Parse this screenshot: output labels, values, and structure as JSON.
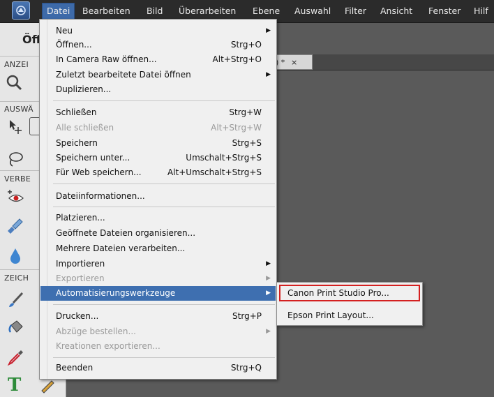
{
  "menubar": {
    "items": [
      "Datei",
      "Bearbeiten",
      "Bild",
      "Überarbeiten",
      "Ebene",
      "Auswahl",
      "Filter",
      "Ansicht",
      "Fenster",
      "Hilf"
    ]
  },
  "panel": {
    "heading": "Öff",
    "sections": [
      "ANZEI",
      "AUSWÄ",
      "VERBE",
      "ZEICH"
    ]
  },
  "doc_tab": {
    "mark": ") *",
    "close": "×"
  },
  "file_menu": {
    "items": [
      {
        "label": "Neu",
        "shortcut": "",
        "submenu": true,
        "disabled": false
      },
      {
        "label": "Öffnen...",
        "shortcut": "Strg+O",
        "submenu": false,
        "disabled": false
      },
      {
        "label": "In Camera Raw öffnen...",
        "shortcut": "Alt+Strg+O",
        "submenu": false,
        "disabled": false
      },
      {
        "label": "Zuletzt bearbeitete Datei öffnen",
        "shortcut": "",
        "submenu": true,
        "disabled": false
      },
      {
        "label": "Duplizieren...",
        "shortcut": "",
        "submenu": false,
        "disabled": false
      },
      {
        "label": "Schließen",
        "shortcut": "Strg+W",
        "submenu": false,
        "disabled": false
      },
      {
        "label": "Alle schließen",
        "shortcut": "Alt+Strg+W",
        "submenu": false,
        "disabled": true
      },
      {
        "label": "Speichern",
        "shortcut": "Strg+S",
        "submenu": false,
        "disabled": false
      },
      {
        "label": "Speichern unter...",
        "shortcut": "Umschalt+Strg+S",
        "submenu": false,
        "disabled": false
      },
      {
        "label": "Für Web speichern...",
        "shortcut": "Alt+Umschalt+Strg+S",
        "submenu": false,
        "disabled": false
      },
      {
        "label": "Dateiinformationen...",
        "shortcut": "",
        "submenu": false,
        "disabled": false
      },
      {
        "label": "Platzieren...",
        "shortcut": "",
        "submenu": false,
        "disabled": false
      },
      {
        "label": "Geöffnete Dateien organisieren...",
        "shortcut": "",
        "submenu": false,
        "disabled": false
      },
      {
        "label": "Mehrere Dateien verarbeiten...",
        "shortcut": "",
        "submenu": false,
        "disabled": false
      },
      {
        "label": "Importieren",
        "shortcut": "",
        "submenu": true,
        "disabled": false
      },
      {
        "label": "Exportieren",
        "shortcut": "",
        "submenu": true,
        "disabled": true
      },
      {
        "label": "Automatisierungswerkzeuge",
        "shortcut": "",
        "submenu": true,
        "disabled": false,
        "highlighted": true
      },
      {
        "label": "Drucken...",
        "shortcut": "Strg+P",
        "submenu": false,
        "disabled": false
      },
      {
        "label": "Abzüge bestellen...",
        "shortcut": "",
        "submenu": true,
        "disabled": true
      },
      {
        "label": "Kreationen exportieren...",
        "shortcut": "",
        "submenu": false,
        "disabled": true
      },
      {
        "label": "Beenden",
        "shortcut": "Strg+Q",
        "submenu": false,
        "disabled": false
      }
    ]
  },
  "submenu": {
    "items": [
      "Canon Print Studio Pro...",
      "Epson Print Layout..."
    ],
    "highlighted_index": 0
  },
  "colors": {
    "menubar_bg": "#2b2b2b",
    "highlight": "#3e6fb0",
    "callout_border": "#d42020"
  }
}
